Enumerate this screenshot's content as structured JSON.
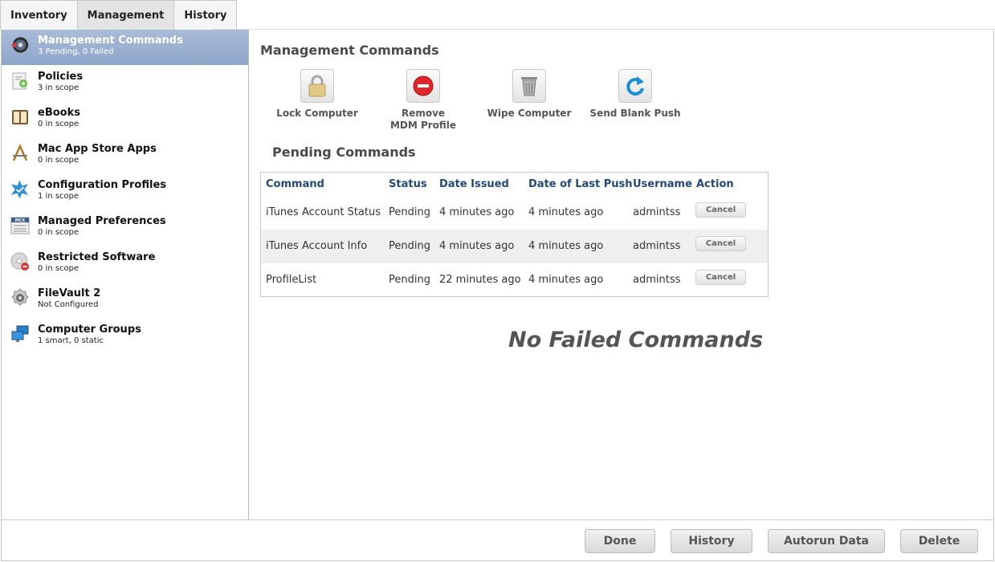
{
  "tabs": [
    {
      "label": "Inventory"
    },
    {
      "label": "Management"
    },
    {
      "label": "History"
    }
  ],
  "active_tab": "Management",
  "sidebar": {
    "items": [
      {
        "title": "Management Commands",
        "sub": "3 Pending, 0 Failed",
        "icon": "management-commands-icon"
      },
      {
        "title": "Policies",
        "sub": "3 in scope",
        "icon": "policies-icon"
      },
      {
        "title": "eBooks",
        "sub": "0 in scope",
        "icon": "ebooks-icon"
      },
      {
        "title": "Mac App Store Apps",
        "sub": "0 in scope",
        "icon": "app-store-icon"
      },
      {
        "title": "Configuration Profiles",
        "sub": "1 in scope",
        "icon": "configuration-profiles-icon"
      },
      {
        "title": "Managed Preferences",
        "sub": "0 in scope",
        "icon": "mcx-icon"
      },
      {
        "title": "Restricted Software",
        "sub": "0 in scope",
        "icon": "restricted-software-icon"
      },
      {
        "title": "FileVault 2",
        "sub": "Not Configured",
        "icon": "filevault-icon"
      },
      {
        "title": "Computer Groups",
        "sub": "1 smart, 0 static",
        "icon": "computer-groups-icon"
      }
    ]
  },
  "main": {
    "title": "Management Commands",
    "commands": [
      {
        "label": "Lock Computer",
        "icon": "lock-icon"
      },
      {
        "label": "Remove MDM Profile",
        "icon": "remove-icon"
      },
      {
        "label": "Wipe Computer",
        "icon": "trash-icon"
      },
      {
        "label": "Send Blank Push",
        "icon": "refresh-icon"
      }
    ],
    "pending_title": "Pending Commands",
    "table": {
      "headers": [
        "Command",
        "Status",
        "Date Issued",
        "Date of Last Push",
        "Username",
        "Action"
      ],
      "rows": [
        {
          "command": "iTunes Account Status",
          "status": "Pending",
          "issued": "4 minutes ago",
          "last_push": "4 minutes ago",
          "username": "admintss",
          "action": "Cancel"
        },
        {
          "command": "iTunes Account Info",
          "status": "Pending",
          "issued": "4 minutes ago",
          "last_push": "4 minutes ago",
          "username": "admintss",
          "action": "Cancel"
        },
        {
          "command": "ProfileList",
          "status": "Pending",
          "issued": "22 minutes ago",
          "last_push": "4 minutes ago",
          "username": "admintss",
          "action": "Cancel"
        }
      ]
    },
    "no_failed": "No Failed Commands"
  },
  "footer": {
    "done": "Done",
    "history": "History",
    "autorun": "Autorun Data",
    "delete": "Delete"
  },
  "colors": {
    "selection": "#9fb4d3",
    "header_text": "#24487a",
    "remove_red": "#e0262b",
    "push_blue": "#1b8fd6"
  }
}
